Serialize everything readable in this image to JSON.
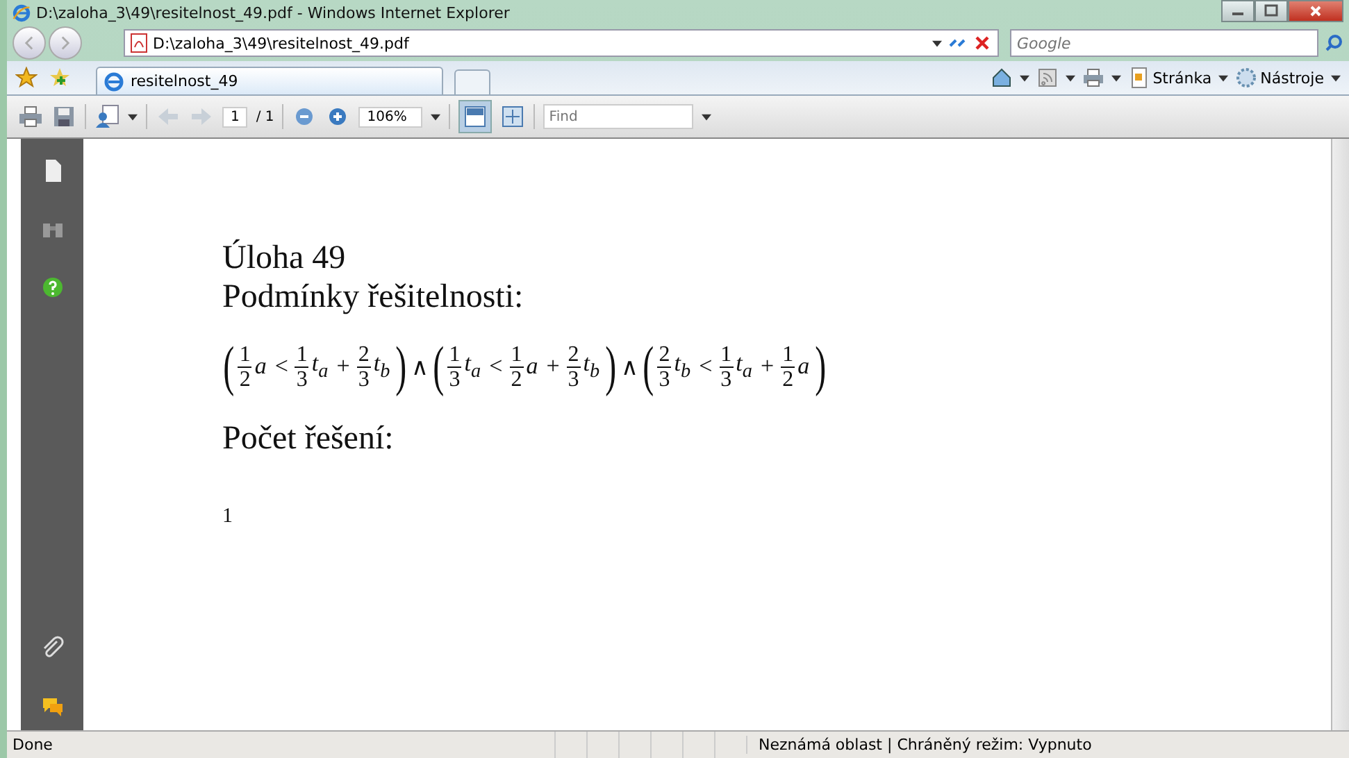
{
  "window": {
    "title": "D:\\zaloha_3\\49\\resitelnost_49.pdf - Windows Internet Explorer"
  },
  "address_bar": {
    "value": "D:\\zaloha_3\\49\\resitelnost_49.pdf"
  },
  "search": {
    "placeholder": "Google"
  },
  "tabs": [
    {
      "label": "resitelnost_49",
      "selected": true
    }
  ],
  "command_bar": [
    {
      "kind": "home"
    },
    {
      "kind": "feed"
    },
    {
      "kind": "print"
    },
    {
      "kind": "page",
      "label": "Stránka"
    },
    {
      "kind": "tools",
      "label": "Nástroje"
    }
  ],
  "pdf_toolbar": {
    "page": "1",
    "page_count": "/ 1",
    "zoom": "106%",
    "find_placeholder": "Find"
  },
  "document": {
    "heading": "Úloha 49",
    "subheading": "Podmínky řešitelnosti:",
    "formula": [
      {
        "kind": "open",
        "text": "("
      },
      {
        "kind": "frac",
        "num": "1",
        "den": "2"
      },
      {
        "kind": "var",
        "text": "a"
      },
      {
        "kind": "op",
        "text": "<"
      },
      {
        "kind": "frac",
        "num": "1",
        "den": "3"
      },
      {
        "kind": "var",
        "text": "t$_{a}$"
      },
      {
        "kind": "op",
        "text": "+"
      },
      {
        "kind": "frac",
        "num": "2",
        "den": "3"
      },
      {
        "kind": "var",
        "text": "t$_{b}$"
      },
      {
        "kind": "close",
        "text": ")"
      },
      {
        "kind": "op",
        "text": "∧"
      },
      {
        "kind": "open",
        "text": "("
      },
      {
        "kind": "frac",
        "num": "1",
        "den": "3"
      },
      {
        "kind": "var",
        "text": "t$_{a}$"
      },
      {
        "kind": "op",
        "text": "<"
      },
      {
        "kind": "frac",
        "num": "1",
        "den": "2"
      },
      {
        "kind": "var",
        "text": "a"
      },
      {
        "kind": "op",
        "text": "+"
      },
      {
        "kind": "frac",
        "num": "2",
        "den": "3"
      },
      {
        "kind": "var",
        "text": "t$_{b}$"
      },
      {
        "kind": "close",
        "text": ")"
      },
      {
        "kind": "op",
        "text": "∧"
      },
      {
        "kind": "open",
        "text": "("
      },
      {
        "kind": "frac",
        "num": "2",
        "den": "3"
      },
      {
        "kind": "var",
        "text": "t$_{b}$"
      },
      {
        "kind": "op",
        "text": "<"
      },
      {
        "kind": "frac",
        "num": "1",
        "den": "3"
      },
      {
        "kind": "var",
        "text": "t$_{a}$"
      },
      {
        "kind": "op",
        "text": "+"
      },
      {
        "kind": "frac",
        "num": "1",
        "den": "2"
      },
      {
        "kind": "var",
        "text": "a"
      },
      {
        "kind": "close",
        "text": ")"
      }
    ],
    "count_label": "Počet řešení:",
    "count_value": "1"
  },
  "status_bar": {
    "text": "Done",
    "zone": "Neznámá oblast | Chráněný režim: Vypnuto"
  }
}
